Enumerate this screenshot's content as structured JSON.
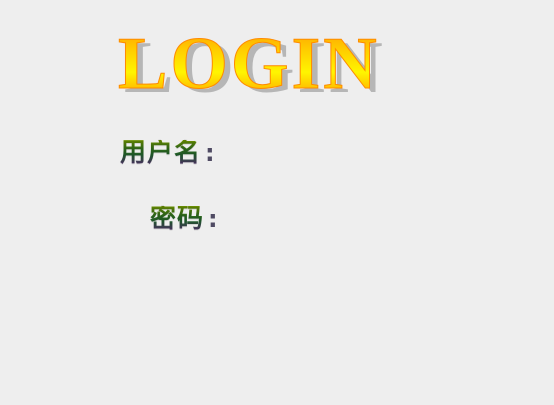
{
  "header": {
    "title": "LOGIN"
  },
  "form": {
    "username_label": "用户名",
    "password_label": "密码",
    "colon": ":"
  }
}
